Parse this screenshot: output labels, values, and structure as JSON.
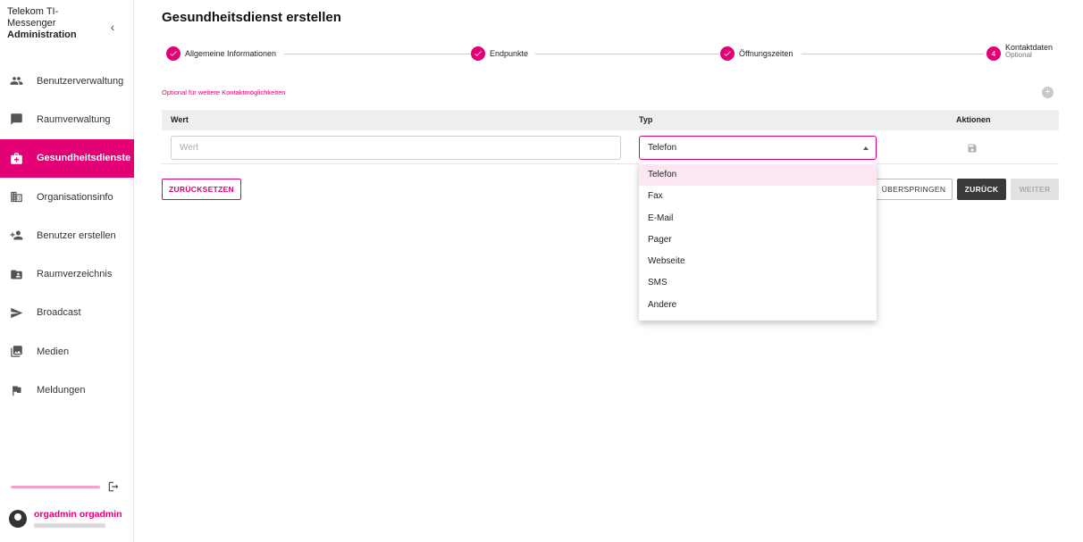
{
  "app": {
    "title_line1": "Telekom TI-",
    "title_line2": "Messenger",
    "title_line3": "Administration",
    "collapse_glyph": "‹"
  },
  "sidebar": {
    "items": [
      {
        "label": "Benutzerverwaltung",
        "icon": "people-icon"
      },
      {
        "label": "Raumverwaltung",
        "icon": "chat-icon"
      },
      {
        "label": "Gesundheitsdienste",
        "icon": "medical-bag-icon",
        "active": true
      },
      {
        "label": "Organisationsinfo",
        "icon": "building-icon"
      },
      {
        "label": "Benutzer erstellen",
        "icon": "person-add-icon"
      },
      {
        "label": "Raumverzeichnis",
        "icon": "folder-contact-icon"
      },
      {
        "label": "Broadcast",
        "icon": "send-icon"
      },
      {
        "label": "Medien",
        "icon": "media-icon"
      },
      {
        "label": "Meldungen",
        "icon": "flag-icon"
      }
    ],
    "user_name": "orgadmin orgadmin"
  },
  "main": {
    "title": "Gesundheitsdienst erstellen",
    "steps": [
      {
        "label": "Allgemeine Informationen",
        "state": "done"
      },
      {
        "label": "Endpunkte",
        "state": "done"
      },
      {
        "label": "Öffnungszeiten",
        "state": "done"
      },
      {
        "label": "Kontaktdaten",
        "number": "4",
        "sublabel": "Optional",
        "state": "active"
      }
    ],
    "hint": "Optional für weitere Kontaktmöglichkeiten",
    "add_glyph": "+",
    "table": {
      "headers": [
        "Wert",
        "Typ",
        "Aktionen"
      ],
      "row": {
        "wert_placeholder": "Wert",
        "typ_value": "Telefon"
      }
    },
    "buttons": {
      "reset": "ZURÜCKSETZEN",
      "skip": "ÜBERSPRINGEN",
      "back": "ZURÜCK",
      "next": "WEITER"
    },
    "dropdown_options": [
      "Telefon",
      "Fax",
      "E-Mail",
      "Pager",
      "Webseite",
      "SMS",
      "Andere"
    ]
  },
  "colors": {
    "accent": "#e20074",
    "dark_button": "#3a3a3a"
  }
}
